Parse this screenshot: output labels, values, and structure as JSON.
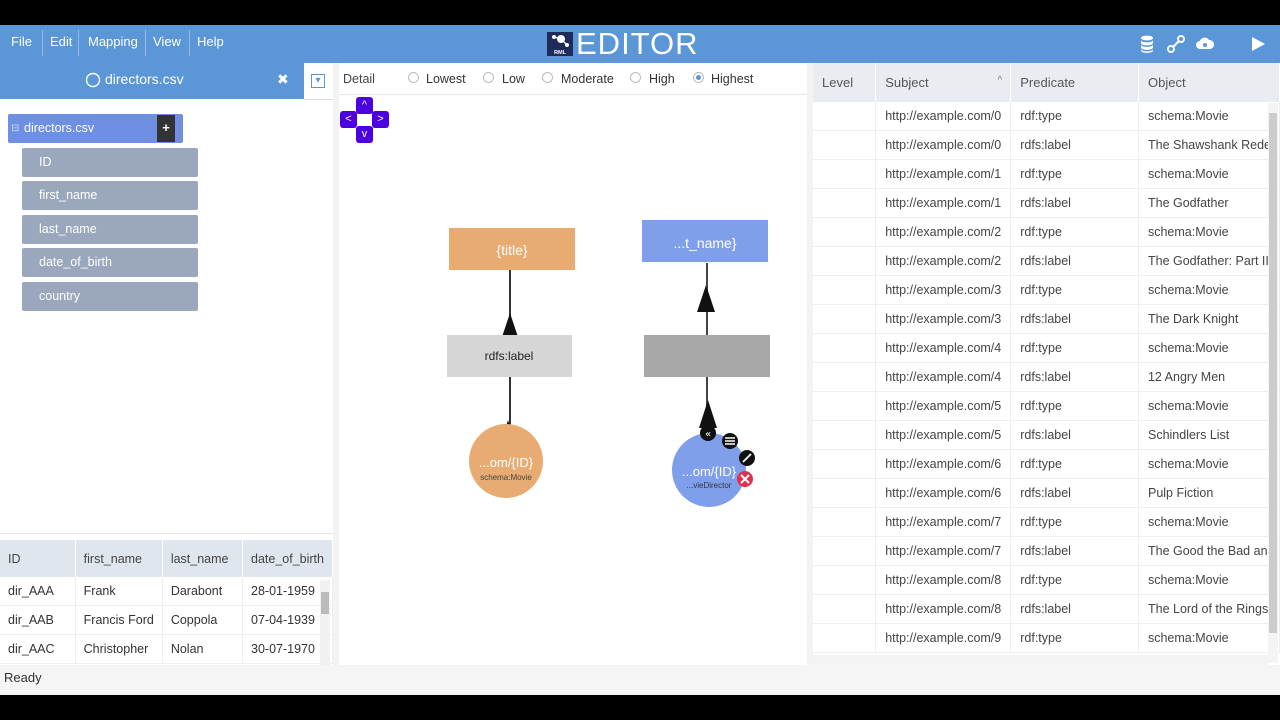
{
  "menu": [
    "File",
    "Edit",
    "Mapping",
    "View",
    "Help"
  ],
  "logo": {
    "small_label": "RML",
    "title": "EDITOR"
  },
  "header_icons": [
    "database-icon",
    "link-icon",
    "cloud-icon",
    "play-icon"
  ],
  "source_tab": {
    "title": "directors.csv",
    "close": "✖",
    "dropdown": "▾"
  },
  "source_node": {
    "label": "directors.csv",
    "add": "+"
  },
  "fields": [
    "ID",
    "first_name",
    "last_name",
    "date_of_birth",
    "country"
  ],
  "data_table": {
    "columns": [
      "ID",
      "first_name",
      "last_name",
      "date_of_birth"
    ],
    "rows": [
      [
        "dir_AAA",
        "Frank",
        "Darabont",
        "28-01-1959"
      ],
      [
        "dir_AAB",
        "Francis Ford",
        "Coppola",
        "07-04-1939"
      ],
      [
        "dir_AAC",
        "Christopher",
        "Nolan",
        "30-07-1970"
      ]
    ]
  },
  "detail": {
    "label": "Detail",
    "options": [
      "Lowest",
      "Low",
      "Moderate",
      "High",
      "Highest"
    ],
    "selected": "Highest"
  },
  "nav": {
    "up": "^",
    "left": "<",
    "right": ">",
    "down": "v"
  },
  "graph": {
    "movie": {
      "object": "{title}",
      "predicate": "rdfs:label",
      "subject": "...om/{ID}",
      "class": "schema:Movie",
      "color": "#e8ab72"
    },
    "director": {
      "object": "...t_name}",
      "predicate": "",
      "subject": "...om/{ID}",
      "class": "...vieDirector",
      "color": "#7f9fea"
    }
  },
  "triples": {
    "columns": [
      "Level",
      "Subject",
      "Predicate",
      "Object"
    ],
    "sort_indicator": "^",
    "rows": [
      [
        "",
        "http://example.com/0",
        "rdf:type",
        "schema:Movie"
      ],
      [
        "",
        "http://example.com/0",
        "rdfs:label",
        "The Shawshank Rede"
      ],
      [
        "",
        "http://example.com/1",
        "rdf:type",
        "schema:Movie"
      ],
      [
        "",
        "http://example.com/1",
        "rdfs:label",
        "The Godfather"
      ],
      [
        "",
        "http://example.com/2",
        "rdf:type",
        "schema:Movie"
      ],
      [
        "",
        "http://example.com/2",
        "rdfs:label",
        "The Godfather: Part II"
      ],
      [
        "",
        "http://example.com/3",
        "rdf:type",
        "schema:Movie"
      ],
      [
        "",
        "http://example.com/3",
        "rdfs:label",
        "The Dark Knight"
      ],
      [
        "",
        "http://example.com/4",
        "rdf:type",
        "schema:Movie"
      ],
      [
        "",
        "http://example.com/4",
        "rdfs:label",
        "12 Angry Men"
      ],
      [
        "",
        "http://example.com/5",
        "rdf:type",
        "schema:Movie"
      ],
      [
        "",
        "http://example.com/5",
        "rdfs:label",
        "Schindlers List"
      ],
      [
        "",
        "http://example.com/6",
        "rdf:type",
        "schema:Movie"
      ],
      [
        "",
        "http://example.com/6",
        "rdfs:label",
        "Pulp Fiction"
      ],
      [
        "",
        "http://example.com/7",
        "rdf:type",
        "schema:Movie"
      ],
      [
        "",
        "http://example.com/7",
        "rdfs:label",
        "The Good the Bad an"
      ],
      [
        "",
        "http://example.com/8",
        "rdf:type",
        "schema:Movie"
      ],
      [
        "",
        "http://example.com/8",
        "rdfs:label",
        "The Lord of the Rings"
      ],
      [
        "",
        "http://example.com/9",
        "rdf:type",
        "schema:Movie"
      ]
    ]
  },
  "status": "Ready",
  "colors": {
    "header": "#5b96d6",
    "field": "#9aa7bc",
    "nav": "#4a00e0",
    "delete": "#e0304e"
  }
}
